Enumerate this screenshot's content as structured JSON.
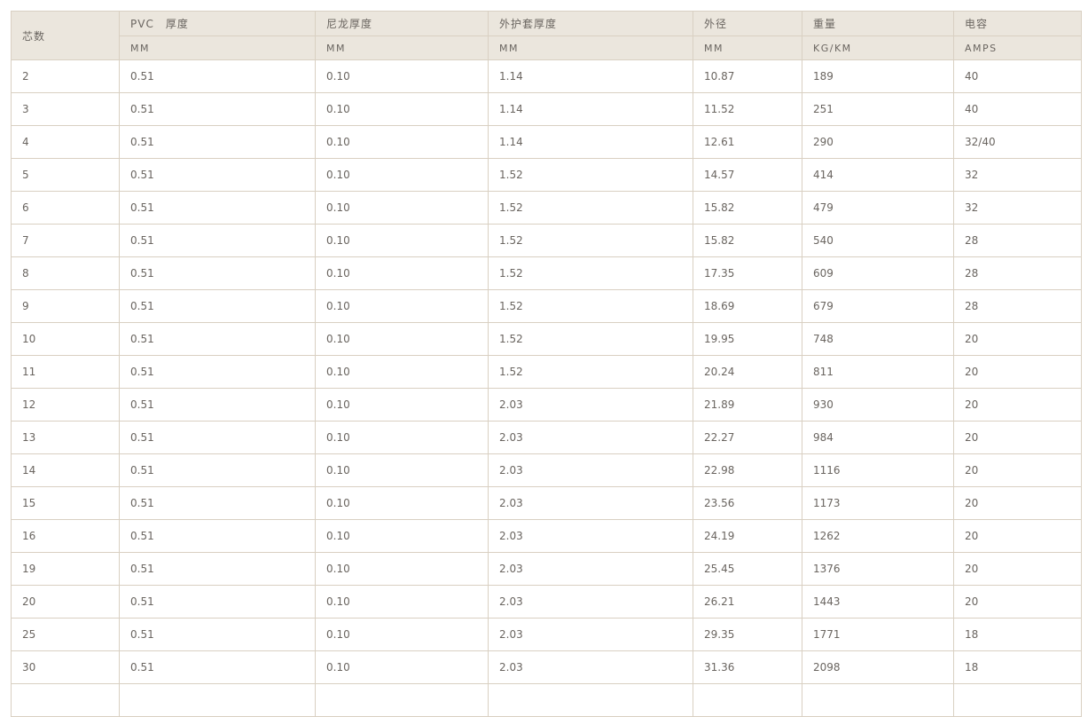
{
  "table": {
    "headers": [
      "芯数",
      "PVC　厚度",
      "尼龙厚度",
      "外护套厚度",
      "外径",
      "重量",
      "电容"
    ],
    "units": [
      "MM",
      "MM",
      "MM",
      "MM",
      "KG/KM",
      "AMPS"
    ],
    "rows": [
      [
        "2",
        "0.51",
        "0.10",
        "1.14",
        "10.87",
        "189",
        "40"
      ],
      [
        "3",
        "0.51",
        "0.10",
        "1.14",
        "11.52",
        "251",
        "40"
      ],
      [
        "4",
        "0.51",
        "0.10",
        "1.14",
        "12.61",
        "290",
        "32/40"
      ],
      [
        "5",
        "0.51",
        "0.10",
        "1.52",
        "14.57",
        "414",
        "32"
      ],
      [
        "6",
        "0.51",
        "0.10",
        "1.52",
        "15.82",
        "479",
        "32"
      ],
      [
        "7",
        "0.51",
        "0.10",
        "1.52",
        "15.82",
        "540",
        "28"
      ],
      [
        "8",
        "0.51",
        "0.10",
        "1.52",
        "17.35",
        "609",
        "28"
      ],
      [
        "9",
        "0.51",
        "0.10",
        "1.52",
        "18.69",
        "679",
        "28"
      ],
      [
        "10",
        "0.51",
        "0.10",
        "1.52",
        "19.95",
        "748",
        "20"
      ],
      [
        "11",
        "0.51",
        "0.10",
        "1.52",
        "20.24",
        "811",
        "20"
      ],
      [
        "12",
        "0.51",
        "0.10",
        "2.03",
        "21.89",
        "930",
        "20"
      ],
      [
        "13",
        "0.51",
        "0.10",
        "2.03",
        "22.27",
        "984",
        "20"
      ],
      [
        "14",
        "0.51",
        "0.10",
        "2.03",
        "22.98",
        "1116",
        "20"
      ],
      [
        "15",
        "0.51",
        "0.10",
        "2.03",
        "23.56",
        "1173",
        "20"
      ],
      [
        "16",
        "0.51",
        "0.10",
        "2.03",
        "24.19",
        "1262",
        "20"
      ],
      [
        "19",
        "0.51",
        "0.10",
        "2.03",
        "25.45",
        "1376",
        "20"
      ],
      [
        "20",
        "0.51",
        "0.10",
        "2.03",
        "26.21",
        "1443",
        "20"
      ],
      [
        "25",
        "0.51",
        "0.10",
        "2.03",
        "29.35",
        "1771",
        "18"
      ],
      [
        "30",
        "0.51",
        "0.10",
        "2.03",
        "31.36",
        "2098",
        "18"
      ],
      [
        "",
        "",
        "",
        "",
        "",
        "",
        ""
      ]
    ]
  },
  "colors": {
    "header_bg": "#ebe6dd",
    "border": "#d9d0c2",
    "text": "#6a6560"
  }
}
